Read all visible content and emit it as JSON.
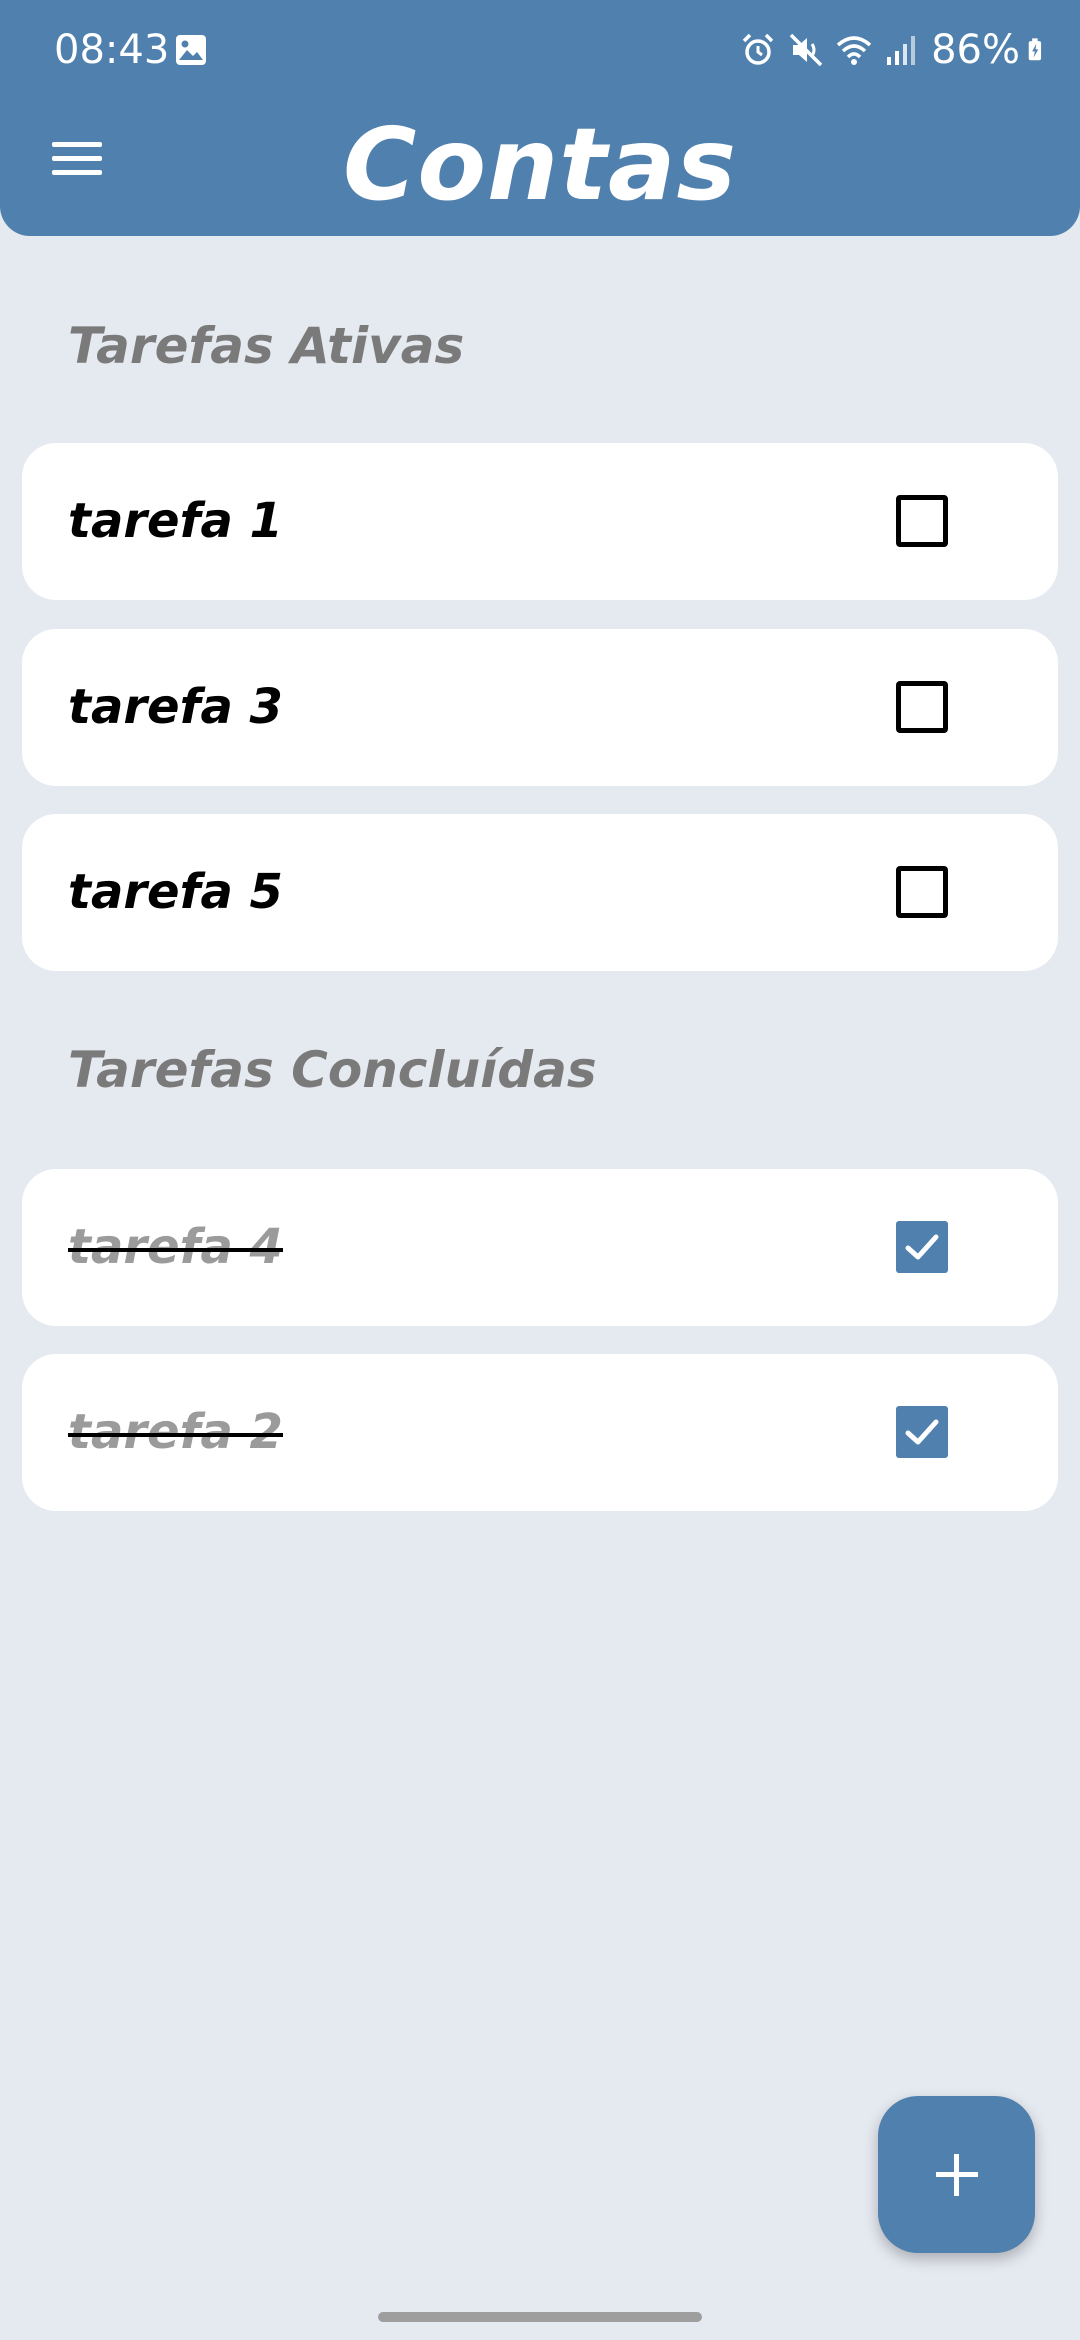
{
  "status_bar": {
    "time": "08:43",
    "battery": "86%",
    "icons": [
      "gallery-icon",
      "alarm-icon",
      "mute-icon",
      "wifi-icon",
      "signal-icon",
      "battery-charging-icon"
    ]
  },
  "header": {
    "title": "Contas",
    "menu_icon": "hamburger-menu-icon",
    "background_color": "#5080ad"
  },
  "active_section": {
    "title": "Tarefas Ativas",
    "tasks": [
      {
        "label": "tarefa 1",
        "checked": false
      },
      {
        "label": "tarefa 3",
        "checked": false
      },
      {
        "label": "tarefa 5",
        "checked": false
      }
    ]
  },
  "completed_section": {
    "title": "Tarefas Concluídas",
    "tasks": [
      {
        "label": "tarefa 4",
        "checked": true
      },
      {
        "label": "tarefa 2",
        "checked": true
      }
    ]
  },
  "fab": {
    "icon": "plus-icon"
  },
  "colors": {
    "accent": "#5080ad",
    "background": "#e5e9f0",
    "card": "#ffffff",
    "section_title": "#7a7a7a",
    "done_text": "#9b9b9b"
  }
}
